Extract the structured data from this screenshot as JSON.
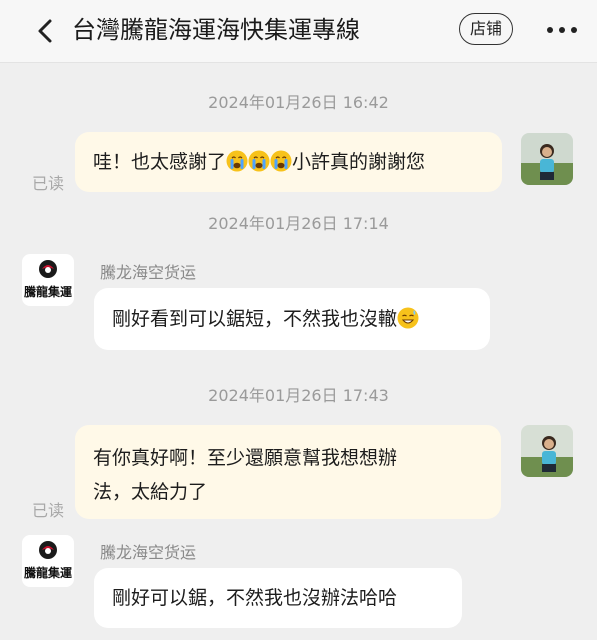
{
  "header": {
    "title": "台灣騰龍海運海快集運專線",
    "shop_label": "店铺"
  },
  "chat": {
    "timestamps": [
      "2024年01月26日 16:42",
      "2024年01月26日 17:14",
      "2024年01月26日 17:43"
    ],
    "read_label": "已读",
    "shop_name": "騰龙海空货运",
    "shop_logo_text": "騰龍集運",
    "messages": [
      {
        "from": "user",
        "text_before": "哇！也太感謝了",
        "emoji": "crying-face",
        "text_after": "小許真的謝謝您"
      },
      {
        "from": "shop",
        "text": "剛好看到可以鋸短，不然我也沒轍",
        "emoji": "sweat-smile-face"
      },
      {
        "from": "user",
        "line1": "有你真好啊！至少還願意幫我想想辦",
        "line2": "法，太給力了"
      },
      {
        "from": "shop",
        "text": "剛好可以鋸，不然我也沒辦法哈哈"
      }
    ]
  },
  "colors": {
    "user_bubble": "#fff9e8",
    "shop_bubble": "#ffffff",
    "background": "#efefef"
  }
}
